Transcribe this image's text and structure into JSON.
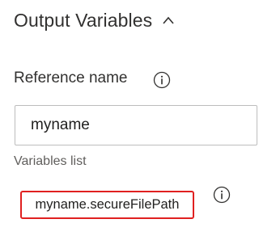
{
  "section": {
    "title": "Output Variables",
    "chevron_icon": "chevron-up-icon"
  },
  "reference_name": {
    "label": "Reference name",
    "info_icon": "info-icon",
    "value": "myname"
  },
  "variables_list": {
    "label": "Variables list",
    "info_icon": "info-icon",
    "items": [
      "myname.secureFilePath"
    ]
  },
  "colors": {
    "text": "#323130",
    "secondary_text": "#605e5c",
    "input_border": "#bdbdbd",
    "highlight_border": "#e02020"
  }
}
